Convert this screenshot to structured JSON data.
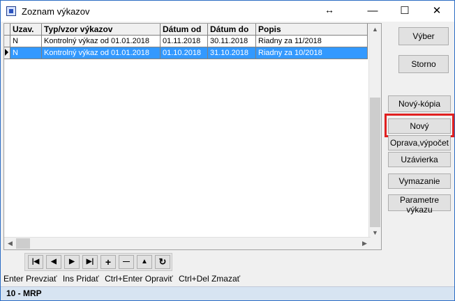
{
  "window": {
    "title": "Zoznam výkazov",
    "resize_glyph": "↔",
    "minimize_glyph": "—",
    "maximize_glyph": "☐",
    "close_glyph": "✕"
  },
  "table": {
    "columns": [
      "Uzav.",
      "Typ/vzor výkazov",
      "Dátum od",
      "Dátum do",
      "Popis"
    ],
    "rows": [
      {
        "uzav": "N",
        "typ": "Kontrolný výkaz od 01.01.2018",
        "od": "01.11.2018",
        "do": "30.11.2018",
        "popis": "Riadny za 11/2018",
        "selected": false
      },
      {
        "uzav": "N",
        "typ": "Kontrolný výkaz od 01.01.2018",
        "od": "01.10.2018",
        "do": "31.10.2018",
        "popis": "Riadny za 10/2018",
        "selected": true
      }
    ]
  },
  "buttons": {
    "vyber": "Výber",
    "storno": "Storno",
    "novy_kopia": "Nový-kópia",
    "novy": "Nový",
    "oprava": "Oprava,výpočet",
    "uzavierka": "Uzávierka",
    "vymazanie": "Vymazanie",
    "parametre": "Parametre výkazu"
  },
  "navigator": {
    "first": "|◀",
    "prev": "◀",
    "next": "▶",
    "last": "▶|",
    "insert": "+",
    "delete": "—",
    "up": "▲",
    "refresh": "↻"
  },
  "shortcuts": [
    "Enter Prevziať",
    "Ins Pridať",
    "Ctrl+Enter Opraviť",
    "Ctrl+Del Zmazať"
  ],
  "status": "10 - MRP",
  "colors": {
    "selection": "#3399ff",
    "highlight": "#e02020",
    "status_bar": "#d7e4f2"
  }
}
